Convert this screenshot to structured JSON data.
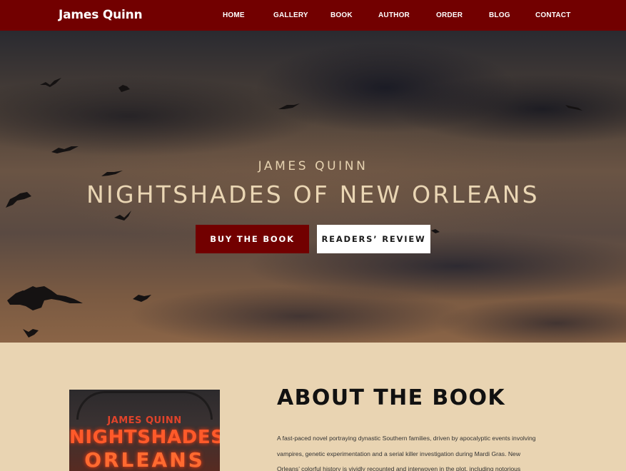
{
  "nav": {
    "brand": "James Quinn",
    "items": [
      "HOME",
      "GALLERY",
      "BOOK",
      "AUTHOR",
      "ORDER",
      "BLOG",
      "CONTACT"
    ]
  },
  "hero": {
    "author": "JAMES QUINN",
    "title": "NIGHTSHADES OF NEW ORLEANS",
    "buy_label": "BUY THE BOOK",
    "review_label": "READERS’ REVIEW"
  },
  "about": {
    "heading": "ABOUT THE BOOK",
    "cover": {
      "author": "JAMES QUINN",
      "line1": "NIGHTSHADES",
      "line2": "ORLEANS"
    },
    "text_lines": [
      "A fast-paced novel portraying dynastic Southern families, driven by apocalyptic events involving",
      "vampires, genetic experimentation and a serial killer investigation during Mardi Gras. New",
      "Orleans’ colorful history is vividly recounted and interwoven in the plot, including notorious"
    ]
  },
  "colors": {
    "nav_bg": "#720000",
    "accent": "#720000",
    "about_bg": "#e9d4b2",
    "hero_text": "#ead6b4"
  }
}
